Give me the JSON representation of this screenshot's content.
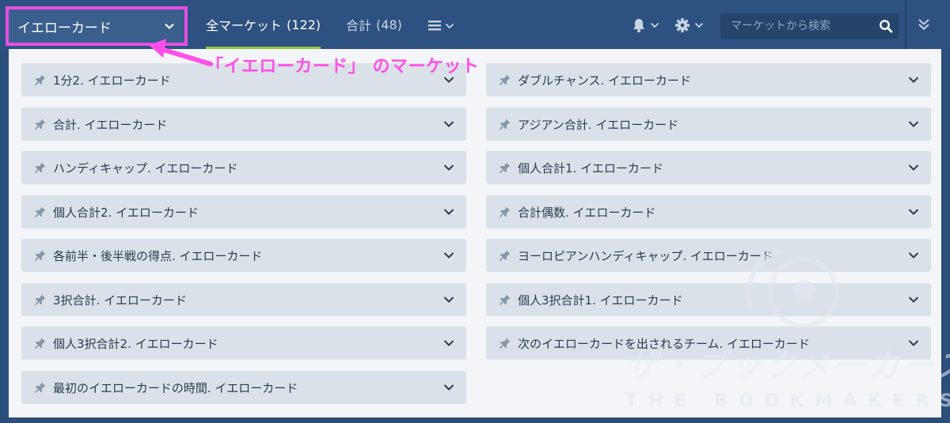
{
  "header": {
    "category_select": "イエローカード",
    "tabs": [
      {
        "label": "全マーケット",
        "count": "(122)"
      },
      {
        "label": "合計",
        "count": "(48)"
      }
    ],
    "search_placeholder": "マーケットから検索",
    "colors": {
      "accent": "#8fc93a",
      "highlight": "#e84fe2"
    }
  },
  "annotation": "「イエローカード」 のマーケット",
  "markets": {
    "left": [
      "1分2. イエローカード",
      "合計. イエローカード",
      "ハンディキャップ. イエローカード",
      "個人合計2. イエローカード",
      "各前半・後半戦の得点. イエローカード",
      "3択合計. イエローカード",
      "個人3択合計2. イエローカード",
      "最初のイエローカードの時間. イエローカード"
    ],
    "right": [
      "ダブルチャンス. イエローカード",
      "アジアン合計. イエローカード",
      "個人合計1. イエローカード",
      "合計偶数. イエローカード",
      "ヨーロピアンハンディキャップ. イエローカード",
      "個人3択合計1. イエローカード",
      "次のイエローカードを出されるチーム. イエローカード"
    ]
  },
  "watermark": {
    "main": "ザ・ブックメーカーズ",
    "sub": "THE BOOKMAKERS"
  },
  "icons": [
    "chevron-down-icon",
    "list-icon",
    "bell-icon",
    "gear-icon",
    "search-icon",
    "double-chevron-down-icon",
    "pin-icon"
  ]
}
